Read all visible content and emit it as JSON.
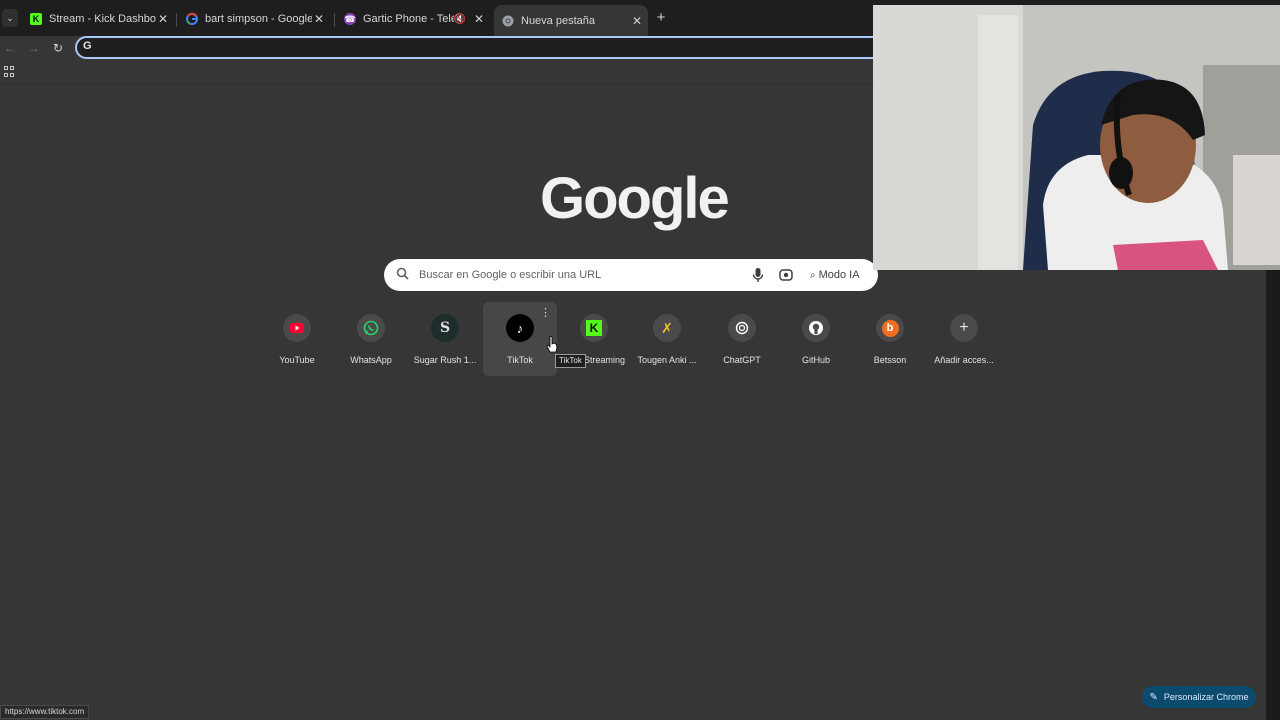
{
  "tabs": [
    {
      "title": "Stream - Kick Dashboard",
      "favicon": "kick-icon",
      "active": false
    },
    {
      "title": "bart simpson - Google Search",
      "favicon": "google-icon",
      "active": false
    },
    {
      "title": "Gartic Phone - Teléfono De",
      "favicon": "gartic-phone-icon",
      "active": false,
      "muted": true
    },
    {
      "title": "Nueva pestaña",
      "favicon": "chrome-icon",
      "active": true
    }
  ],
  "omnibox": {
    "value": "",
    "icon": "google-g-icon"
  },
  "logo_text": "Google",
  "search": {
    "placeholder": "Buscar en Google o escribir una URL",
    "ai_mode_label": "Modo IA"
  },
  "shortcuts": [
    {
      "label": "YouTube",
      "icon": "youtube-icon",
      "color": "#ff0033"
    },
    {
      "label": "WhatsApp",
      "icon": "whatsapp-icon",
      "color": "#25d366"
    },
    {
      "label": "Sugar Rush 1...",
      "icon": "sugar-rush-icon",
      "color": "#1a2a2a"
    },
    {
      "label": "TikTok",
      "icon": "tiktok-icon",
      "color": "#000000",
      "hovered": true
    },
    {
      "label": "Streaming",
      "icon": "kick-icon",
      "color": "#53fc18"
    },
    {
      "label": "Tougen Anki ...",
      "icon": "tougen-anki-icon",
      "color": "#f0c020"
    },
    {
      "label": "ChatGPT",
      "icon": "chatgpt-icon",
      "color": "#ffffff"
    },
    {
      "label": "GitHub",
      "icon": "github-icon",
      "color": "#ffffff"
    },
    {
      "label": "Betsson",
      "icon": "betsson-icon",
      "color": "#f26f21"
    },
    {
      "label": "Añadir acces...",
      "icon": "plus-icon",
      "color": "#e3e3e3"
    }
  ],
  "tooltip": "TikTok",
  "status_url": "https://www.tiktok.com",
  "customize_label": "Personalizar Chrome",
  "colors": {
    "background": "#363636",
    "tabstrip": "#1e1e1e",
    "accent": "#a8c7fa",
    "customize_bg": "#0c4a6e"
  }
}
